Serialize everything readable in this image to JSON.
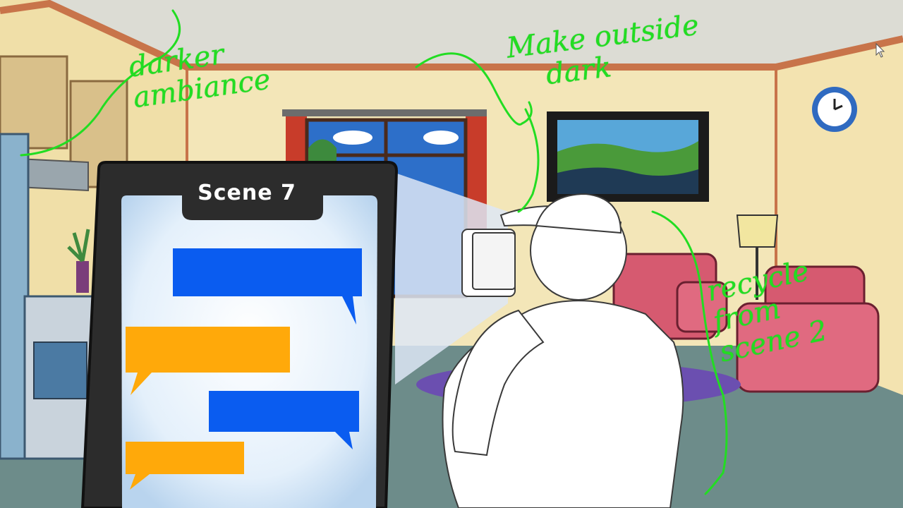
{
  "storyboard": {
    "scene_label": "Scene 7",
    "notes": {
      "ambiance": "darker\nambiance",
      "outside": "Make outside\n    dark",
      "recycle": "recycle\nfrom\nscene 2"
    },
    "chat_bubble_colors": {
      "incoming": "#0a5cf0",
      "outgoing": "#ffa90a"
    },
    "annotation_color": "#22dd22"
  }
}
